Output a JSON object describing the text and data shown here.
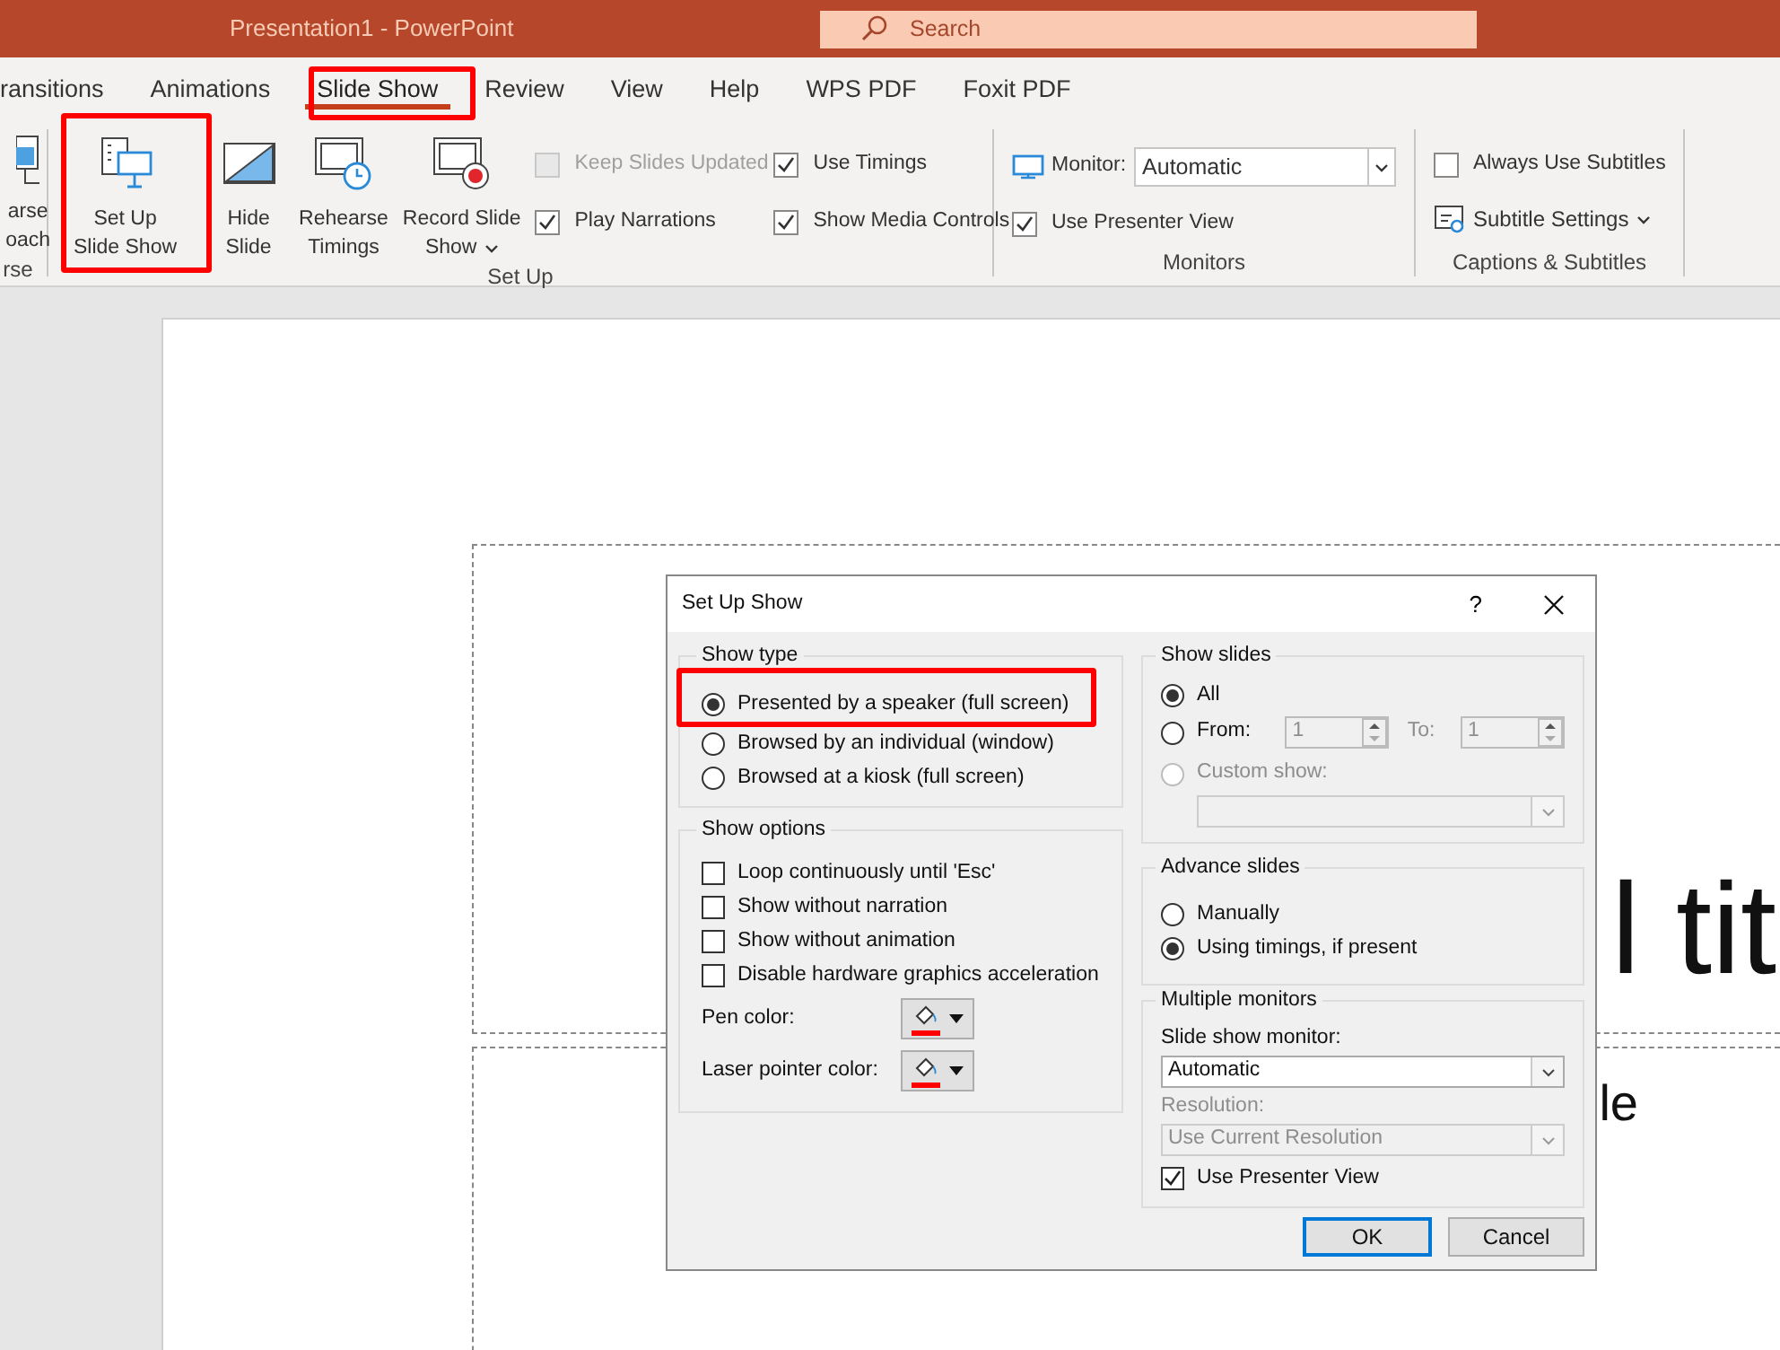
{
  "title_bar": {
    "title": "Presentation1  -  PowerPoint",
    "search_placeholder": "Search"
  },
  "tabs": [
    {
      "label": "ransitions",
      "selected": false
    },
    {
      "label": "Animations",
      "selected": false
    },
    {
      "label": "Slide Show",
      "selected": true
    },
    {
      "label": "Review",
      "selected": false
    },
    {
      "label": "View",
      "selected": false
    },
    {
      "label": "Help",
      "selected": false
    },
    {
      "label": "WPS PDF",
      "selected": false
    },
    {
      "label": "Foxit PDF",
      "selected": false
    }
  ],
  "ribbon_groups": [
    {
      "kind": "buttons",
      "label": "rse",
      "button_sets": [
        [
          {
            "kind": "rehearse-cut",
            "lines": [
              "arse",
              "oach"
            ],
            "dropdown": false
          }
        ]
      ]
    },
    {
      "kind": "setup",
      "label": "Set Up",
      "button_sets": [
        [
          {
            "kind": "setup",
            "lines": [
              "Set Up",
              "Slide Show"
            ],
            "dropdown": false
          },
          {
            "kind": "hide",
            "lines": [
              "Hide",
              "Slide"
            ],
            "dropdown": false
          }
        ],
        [
          {
            "kind": "timer",
            "lines": [
              "Rehearse",
              "Timings"
            ],
            "dropdown": false
          },
          {
            "kind": "record",
            "lines": [
              "Record Slide",
              "Show"
            ],
            "dropdown": true
          }
        ]
      ],
      "checkboxes": [
        {
          "label": "Keep Slides Updated",
          "checked": false,
          "disabled": true
        },
        {
          "label": "Use Timings",
          "checked": true,
          "disabled": false
        },
        {
          "label": "Play Narrations",
          "checked": true,
          "disabled": false
        },
        {
          "label": "Show Media Controls",
          "checked": true,
          "disabled": false
        }
      ]
    },
    {
      "kind": "monitors",
      "label": "Monitors",
      "monitor": {
        "label": "Monitor:",
        "value": "Automatic"
      },
      "checkboxes": [
        {
          "label": "Use Presenter View",
          "checked": true,
          "disabled": false
        }
      ]
    },
    {
      "kind": "captions",
      "label": "Captions & Subtitles",
      "checkboxes": [
        {
          "label": "Always Use Subtitles",
          "checked": false,
          "disabled": false
        }
      ],
      "menu_button": {
        "label": "Subtitle Settings"
      }
    }
  ],
  "slide": {
    "title_fragment": "l tit",
    "subtitle_fragment": "le"
  },
  "dialog": {
    "title": "Set Up Show",
    "help": "?",
    "show_type": {
      "label": "Show type",
      "options": [
        {
          "label": "Presented by a speaker (full screen)",
          "selected": true
        },
        {
          "label": "Browsed by an individual (window)",
          "selected": false
        },
        {
          "label": "Browsed at a kiosk (full screen)",
          "selected": false
        }
      ]
    },
    "show_options": {
      "label": "Show options",
      "checkboxes": [
        {
          "label": "Loop continuously until 'Esc'",
          "checked": false
        },
        {
          "label": "Show without narration",
          "checked": false
        },
        {
          "label": "Show without animation",
          "checked": false
        },
        {
          "label": "Disable hardware graphics acceleration",
          "checked": false
        }
      ],
      "color_pickers": [
        {
          "label": "Pen color:",
          "color": "#ff0000"
        },
        {
          "label": "Laser pointer color:",
          "color": "#ff0000"
        }
      ]
    },
    "show_slides": {
      "label": "Show slides",
      "options": [
        {
          "label": "All",
          "selected": true,
          "disabled": false
        },
        {
          "label": "From:",
          "selected": false,
          "disabled": false
        },
        {
          "label": "Custom show:",
          "selected": false,
          "disabled": true
        }
      ],
      "from_value": "1",
      "to_label": "To:",
      "to_value": "1"
    },
    "advance_slides": {
      "label": "Advance slides",
      "options": [
        {
          "label": "Manually",
          "selected": false
        },
        {
          "label": "Using timings, if present",
          "selected": true
        }
      ]
    },
    "multiple_monitors": {
      "label": "Multiple monitors",
      "monitor_label": "Slide show monitor:",
      "monitor_value": "Automatic",
      "resolution_label": "Resolution:",
      "resolution_value": "Use Current Resolution",
      "resolution_disabled": true,
      "presenter_view": {
        "label": "Use Presenter View",
        "checked": true
      }
    },
    "buttons": [
      {
        "label": "OK",
        "default": true
      },
      {
        "label": "Cancel",
        "default": false
      }
    ]
  }
}
